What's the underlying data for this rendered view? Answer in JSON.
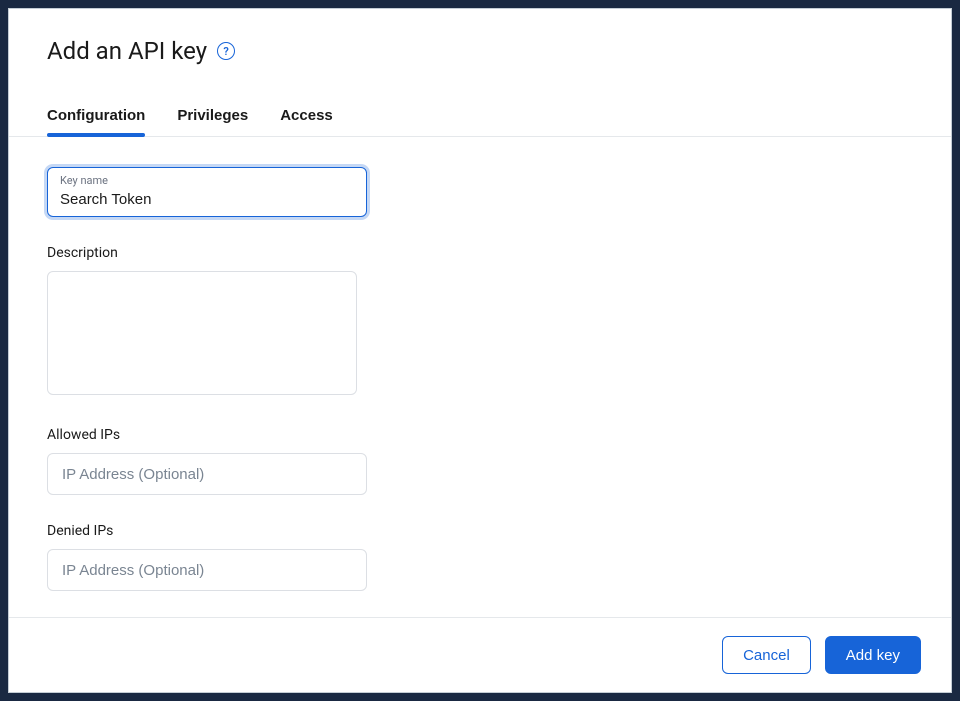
{
  "modal": {
    "title": "Add an API key",
    "help_tooltip": "?"
  },
  "tabs": [
    {
      "label": "Configuration",
      "active": true
    },
    {
      "label": "Privileges",
      "active": false
    },
    {
      "label": "Access",
      "active": false
    }
  ],
  "form": {
    "key_name": {
      "label": "Key name",
      "value": "Search Token"
    },
    "description": {
      "label": "Description",
      "value": ""
    },
    "allowed_ips": {
      "label": "Allowed IPs",
      "placeholder": "IP Address (Optional)",
      "value": ""
    },
    "denied_ips": {
      "label": "Denied IPs",
      "placeholder": "IP Address (Optional)",
      "value": ""
    }
  },
  "footer": {
    "cancel_label": "Cancel",
    "submit_label": "Add key"
  }
}
